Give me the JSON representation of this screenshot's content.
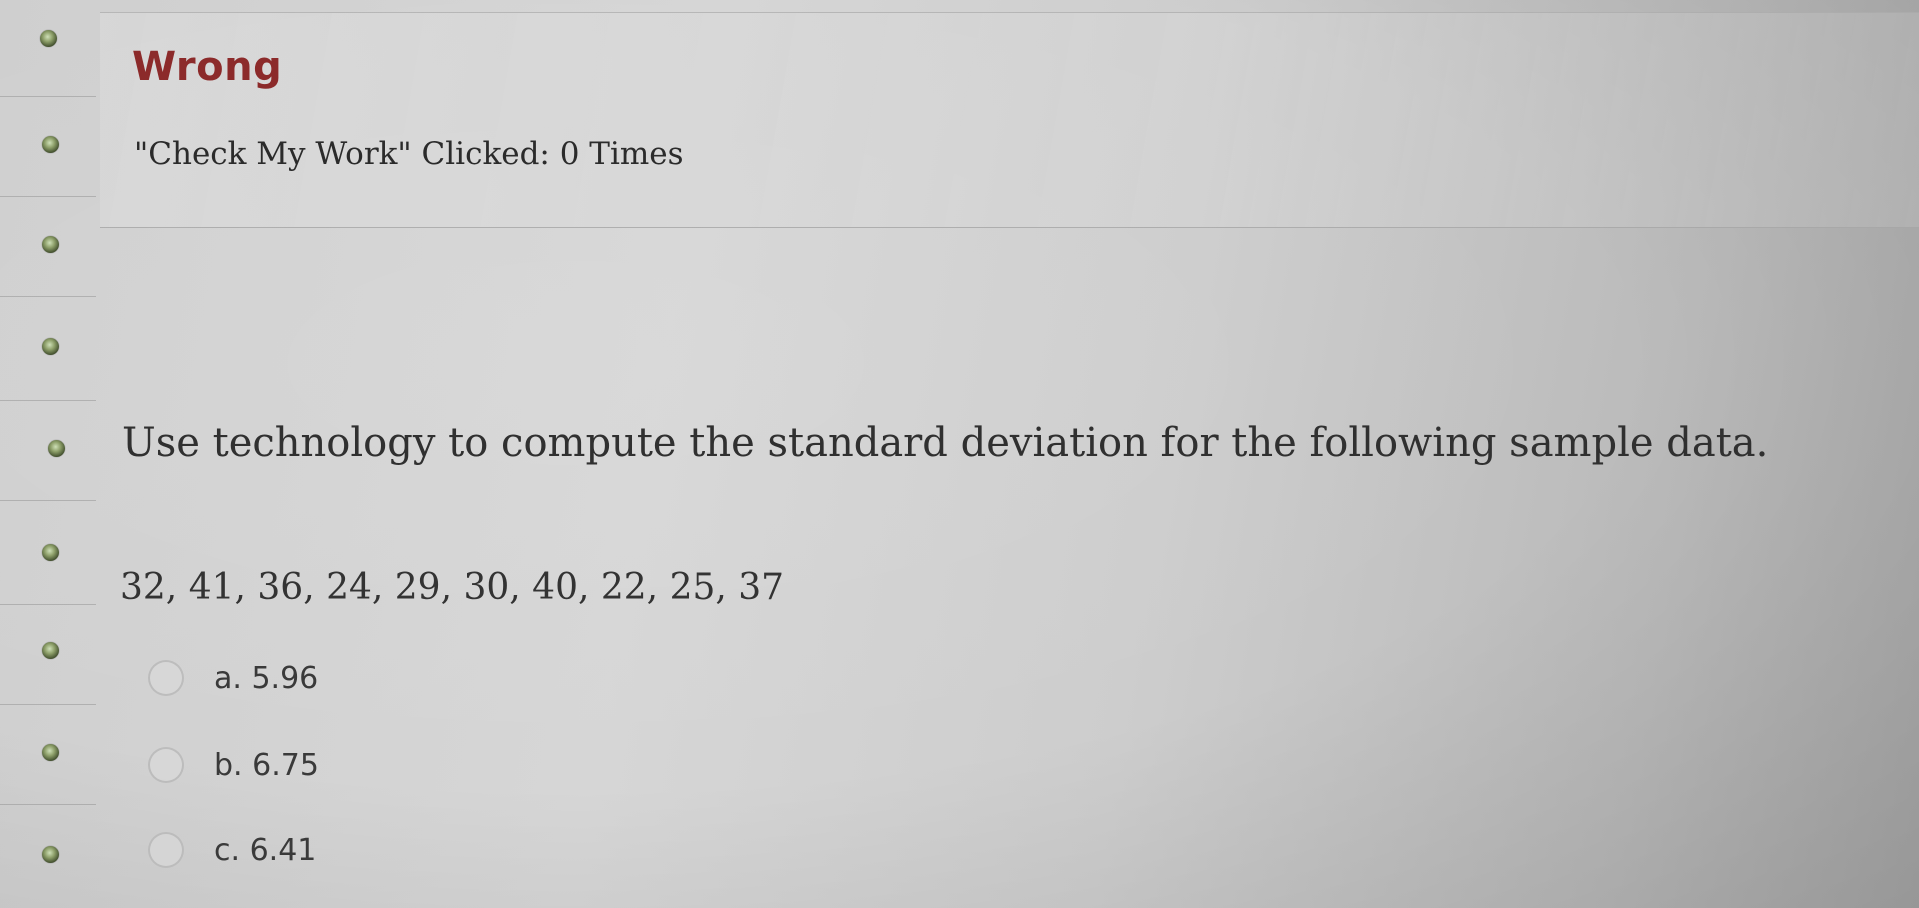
{
  "feedback": {
    "status": "Wrong",
    "check_count": "\"Check My Work\" Clicked: 0 Times"
  },
  "question": {
    "prompt": "Use technology to compute the standard deviation for the following sample data.",
    "data": "32, 41, 36, 24, 29, 30, 40, 22, 25, 37",
    "options": [
      {
        "label": "a. 5.96"
      },
      {
        "label": "b. 6.75"
      },
      {
        "label": "c. 6.41"
      }
    ]
  },
  "colors": {
    "status_wrong": "#8c2a2a",
    "nav_dot": "#6f8450"
  }
}
